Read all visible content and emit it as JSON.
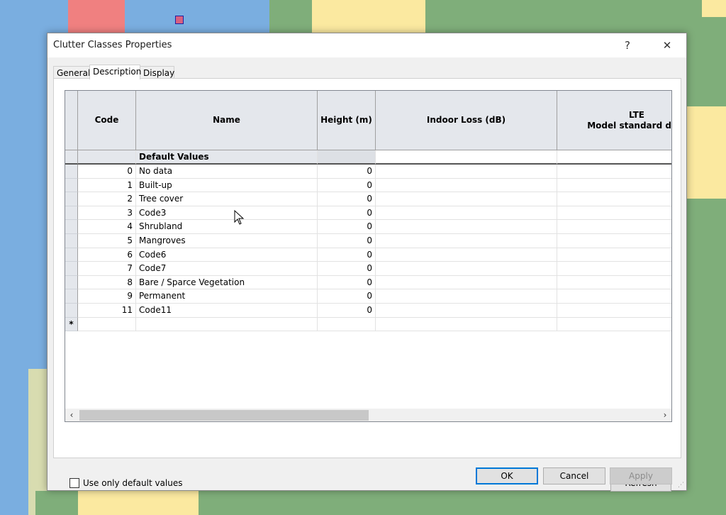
{
  "dialog": {
    "title": "Clutter Classes Properties",
    "help_label": "?",
    "close_label": "✕"
  },
  "tabs": [
    {
      "label": "General"
    },
    {
      "label": "Description"
    },
    {
      "label": "Display"
    }
  ],
  "active_tab": "Description",
  "grid": {
    "columns": {
      "code": "Code",
      "name": "Name",
      "height": "Height (m)",
      "indoor": "Indoor Loss (dB)",
      "lte_line1": "LTE",
      "lte_line2": "Model standard devi"
    },
    "default_row": {
      "name": "Default Values"
    },
    "rows": [
      {
        "code": "0",
        "name": "No data",
        "height": "0"
      },
      {
        "code": "1",
        "name": "Built-up",
        "height": "0"
      },
      {
        "code": "2",
        "name": "Tree cover",
        "height": "0"
      },
      {
        "code": "3",
        "name": "Code3",
        "height": "0"
      },
      {
        "code": "4",
        "name": "Shrubland",
        "height": "0"
      },
      {
        "code": "5",
        "name": "Mangroves",
        "height": "0"
      },
      {
        "code": "6",
        "name": "Code6",
        "height": "0"
      },
      {
        "code": "7",
        "name": "Code7",
        "height": "0"
      },
      {
        "code": "8",
        "name": "Bare / Sparce Vegetation",
        "height": "0"
      },
      {
        "code": "9",
        "name": "Permanent",
        "height": "0"
      },
      {
        "code": "11",
        "name": "Code11",
        "height": "0"
      }
    ],
    "new_row_marker": "*",
    "scroll_left": "‹",
    "scroll_right": "›"
  },
  "options": {
    "use_default_label": "Use only default values",
    "use_default_checked": false
  },
  "buttons": {
    "refresh": "Refresh",
    "ok": "OK",
    "cancel": "Cancel",
    "apply": "Apply"
  },
  "colors": {
    "water": "#7aaee0",
    "land_green": "#7fae7a",
    "land_yellow": "#fbe9a0",
    "built_up": "#f08080"
  }
}
